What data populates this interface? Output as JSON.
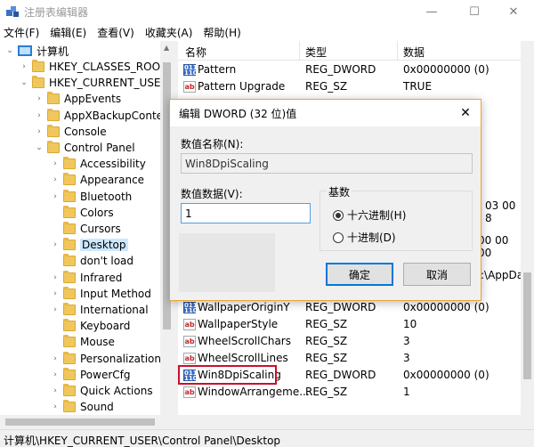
{
  "window": {
    "title": "注册表编辑器",
    "controls": {
      "minimize": "—",
      "maximize": "☐",
      "close": "✕"
    }
  },
  "menu": [
    "文件(F)",
    "编辑(E)",
    "查看(V)",
    "收藏夹(A)",
    "帮助(H)"
  ],
  "tree": {
    "root": "计算机",
    "items": [
      {
        "label": "HKEY_CLASSES_ROOT",
        "level": 1,
        "arrow": "›"
      },
      {
        "label": "HKEY_CURRENT_USER",
        "level": 1,
        "arrow": "⌄"
      },
      {
        "label": "AppEvents",
        "level": 2,
        "arrow": "›"
      },
      {
        "label": "AppXBackupConter",
        "level": 2,
        "arrow": "›"
      },
      {
        "label": "Console",
        "level": 2,
        "arrow": "›"
      },
      {
        "label": "Control Panel",
        "level": 2,
        "arrow": "⌄"
      },
      {
        "label": "Accessibility",
        "level": 3,
        "arrow": "›"
      },
      {
        "label": "Appearance",
        "level": 3,
        "arrow": "›"
      },
      {
        "label": "Bluetooth",
        "level": 3,
        "arrow": "›"
      },
      {
        "label": "Colors",
        "level": 3,
        "arrow": ""
      },
      {
        "label": "Cursors",
        "level": 3,
        "arrow": ""
      },
      {
        "label": "Desktop",
        "level": 3,
        "arrow": "›",
        "selected": true
      },
      {
        "label": "don't load",
        "level": 3,
        "arrow": ""
      },
      {
        "label": "Infrared",
        "level": 3,
        "arrow": "›"
      },
      {
        "label": "Input Method",
        "level": 3,
        "arrow": "›"
      },
      {
        "label": "International",
        "level": 3,
        "arrow": "›"
      },
      {
        "label": "Keyboard",
        "level": 3,
        "arrow": ""
      },
      {
        "label": "Mouse",
        "level": 3,
        "arrow": ""
      },
      {
        "label": "Personalization",
        "level": 3,
        "arrow": "›"
      },
      {
        "label": "PowerCfg",
        "level": 3,
        "arrow": "›"
      },
      {
        "label": "Quick Actions",
        "level": 3,
        "arrow": "›"
      },
      {
        "label": "Sound",
        "level": 3,
        "arrow": "›"
      }
    ]
  },
  "list": {
    "headers": {
      "name": "名称",
      "type": "类型",
      "data": "数据"
    },
    "rows_top": [
      {
        "icon": "dword",
        "name": "Pattern",
        "type": "REG_DWORD",
        "data": "0x00000000 (0)"
      },
      {
        "icon": "sz",
        "name": "Pattern Upgrade",
        "type": "REG_SZ",
        "data": "TRUE"
      }
    ],
    "partial_data": [
      "03 00 8",
      "00 00 00",
      ":\\AppData"
    ],
    "rows_bottom": [
      {
        "icon": "dword",
        "name": "WallpaperOriginY",
        "type": "REG_DWORD",
        "data": "0x00000000 (0)"
      },
      {
        "icon": "sz",
        "name": "WallpaperStyle",
        "type": "REG_SZ",
        "data": "10"
      },
      {
        "icon": "sz",
        "name": "WheelScrollChars",
        "type": "REG_SZ",
        "data": "3"
      },
      {
        "icon": "sz",
        "name": "WheelScrollLines",
        "type": "REG_SZ",
        "data": "3"
      },
      {
        "icon": "dword",
        "name": "Win8DpiScaling",
        "type": "REG_DWORD",
        "data": "0x00000000 (0)"
      },
      {
        "icon": "sz",
        "name": "WindowArrangeme...",
        "type": "REG_SZ",
        "data": "1"
      }
    ]
  },
  "status": {
    "path": "计算机\\HKEY_CURRENT_USER\\Control Panel\\Desktop"
  },
  "dialog": {
    "title": "编辑 DWORD (32 位)值",
    "close": "✕",
    "name_label": "数值名称(N):",
    "name_value": "Win8DpiScaling",
    "data_label": "数值数据(V):",
    "data_value": "1",
    "base_label": "基数",
    "radio_hex": "十六进制(H)",
    "radio_dec": "十进制(D)",
    "ok": "确定",
    "cancel": "取消"
  },
  "colors": {
    "highlight": "#c8102e",
    "dialog_border": "#e8a53c",
    "selected": "#cce8ff",
    "focus": "#0078d7"
  }
}
